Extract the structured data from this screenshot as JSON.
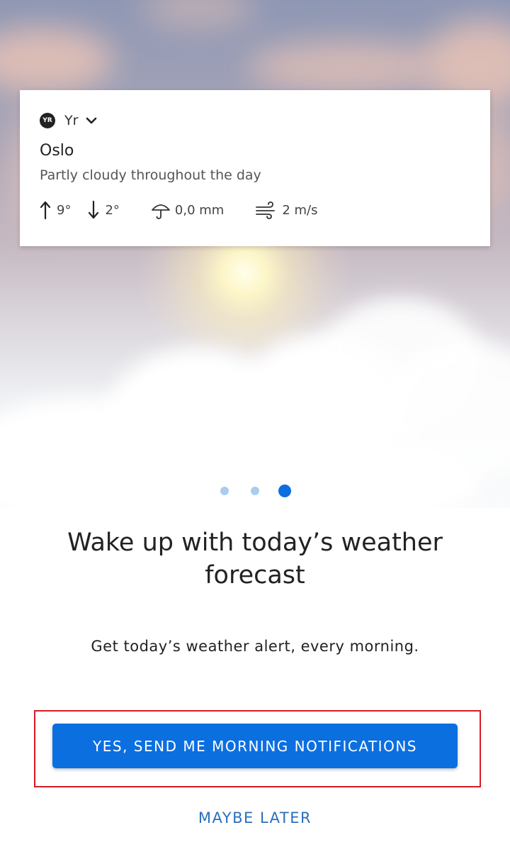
{
  "card": {
    "brand_logo": "YR",
    "brand_name": "Yr",
    "city": "Oslo",
    "condition": "Partly cloudy throughout the day",
    "high_temp": "9°",
    "low_temp": "2°",
    "precipitation": "0,0 mm",
    "wind": "2 m/s",
    "icons": [
      "yr-logo-icon",
      "chevron-down-icon",
      "arrow-up-icon",
      "arrow-down-icon",
      "umbrella-icon",
      "wind-icon"
    ]
  },
  "pager": {
    "count": 3,
    "active_index": 2,
    "active_color": "#0b6fe0",
    "inactive_color": "#a9cdf0"
  },
  "onboarding": {
    "headline": "Wake up with today’s weather forecast",
    "subtext": "Get today’s weather alert, every morning.",
    "primary_button": "YES, SEND ME MORNING NOTIFICATIONS",
    "secondary_button": "MAYBE LATER"
  },
  "colors": {
    "accent": "#0b6fe0",
    "link": "#2a6fbd",
    "highlight_border": "#d31c24"
  }
}
